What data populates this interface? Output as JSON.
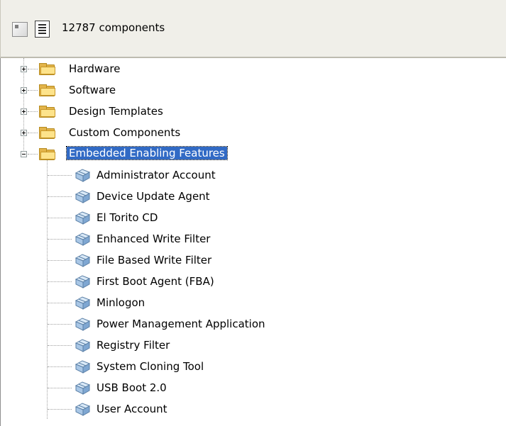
{
  "toolbar": {
    "count_text": "12787 components",
    "icons": [
      "tree-view-icon",
      "list-view-icon"
    ]
  },
  "tree": {
    "top_level": [
      {
        "label": "Hardware",
        "expanded": false
      },
      {
        "label": "Software",
        "expanded": false
      },
      {
        "label": "Design Templates",
        "expanded": false
      },
      {
        "label": "Custom Components",
        "expanded": false
      },
      {
        "label": "Embedded Enabling Features",
        "expanded": true,
        "selected": true
      }
    ],
    "children": [
      "Administrator Account",
      "Device Update Agent",
      "El Torito CD",
      "Enhanced Write Filter",
      "File Based Write Filter",
      "First Boot Agent (FBA)",
      "Minlogon",
      "Power Management Application",
      "Registry Filter",
      "System Cloning Tool",
      "USB Boot 2.0",
      "User Account"
    ]
  },
  "colors": {
    "selection_bg": "#316ac5",
    "folder": "#e3b44a",
    "toolbar_bg": "#f0efe9"
  }
}
